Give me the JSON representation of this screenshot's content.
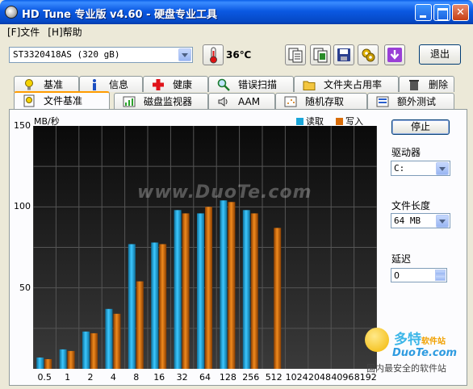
{
  "window": {
    "title": "HD Tune 专业版 v4.60 - 硬盘专业工具",
    "accent_color": "#0b59e3"
  },
  "menu": [
    {
      "label": "[F]文件"
    },
    {
      "label": "[H]帮助"
    }
  ],
  "toolbar": {
    "drive": "ST3320418AS (320 gB)",
    "temperature": "36℃",
    "exit_label": "退出",
    "icons": [
      "thermometer-icon",
      "copy-text-icon",
      "copy-screenshot-icon",
      "save-icon",
      "options-icon",
      "download-icon"
    ]
  },
  "tabs": {
    "row1": [
      {
        "label": "基准",
        "icon": "benchmark-icon"
      },
      {
        "label": "信息",
        "icon": "info-icon"
      },
      {
        "label": "健康",
        "icon": "health-icon"
      },
      {
        "label": "错误扫描",
        "icon": "error-scan-icon"
      },
      {
        "label": "文件夹占用率",
        "icon": "folder-usage-icon"
      },
      {
        "label": "删除",
        "icon": "erase-icon"
      }
    ],
    "row2": [
      {
        "label": "文件基准",
        "icon": "file-benchmark-icon",
        "active": true
      },
      {
        "label": "磁盘监视器",
        "icon": "disk-monitor-icon"
      },
      {
        "label": "AAM",
        "icon": "aam-speaker-icon"
      },
      {
        "label": "随机存取",
        "icon": "random-access-icon"
      },
      {
        "label": "额外测试",
        "icon": "extra-tests-icon"
      }
    ]
  },
  "watermark": {
    "middle": "www.DuoTe.com",
    "brand": "多特",
    "brand_suffix": "软件站",
    "url": "DuoTe.com",
    "slogan": "国内最安全的软件站"
  },
  "right_panel": {
    "stop_label": "停止",
    "drive_label": "驱动器",
    "drive_value": "C:",
    "file_length_label": "文件长度",
    "file_length_value": "64 MB",
    "delay_label": "延迟",
    "delay_value": "0"
  },
  "chart_data": {
    "type": "bar",
    "ylabel": "MB/秒",
    "ylim": [
      0,
      150
    ],
    "yticks": [
      "150",
      "100",
      "50"
    ],
    "categories": [
      "0.5",
      "1",
      "2",
      "4",
      "8",
      "16",
      "32",
      "64",
      "128",
      "256",
      "512",
      "1024",
      "2048",
      "4096",
      "8192"
    ],
    "series": [
      {
        "name": "读取",
        "color": "#1aa6d9",
        "values": [
          7,
          12,
          23,
          37,
          77,
          78,
          98,
          96,
          104,
          98,
          null,
          null,
          null,
          null,
          null
        ]
      },
      {
        "name": "写入",
        "color": "#d86c08",
        "values": [
          6,
          11,
          22,
          34,
          54,
          77,
          96,
          100,
          103,
          96,
          87,
          null,
          null,
          null,
          null
        ]
      }
    ],
    "grid": true,
    "legend": "top-right"
  }
}
